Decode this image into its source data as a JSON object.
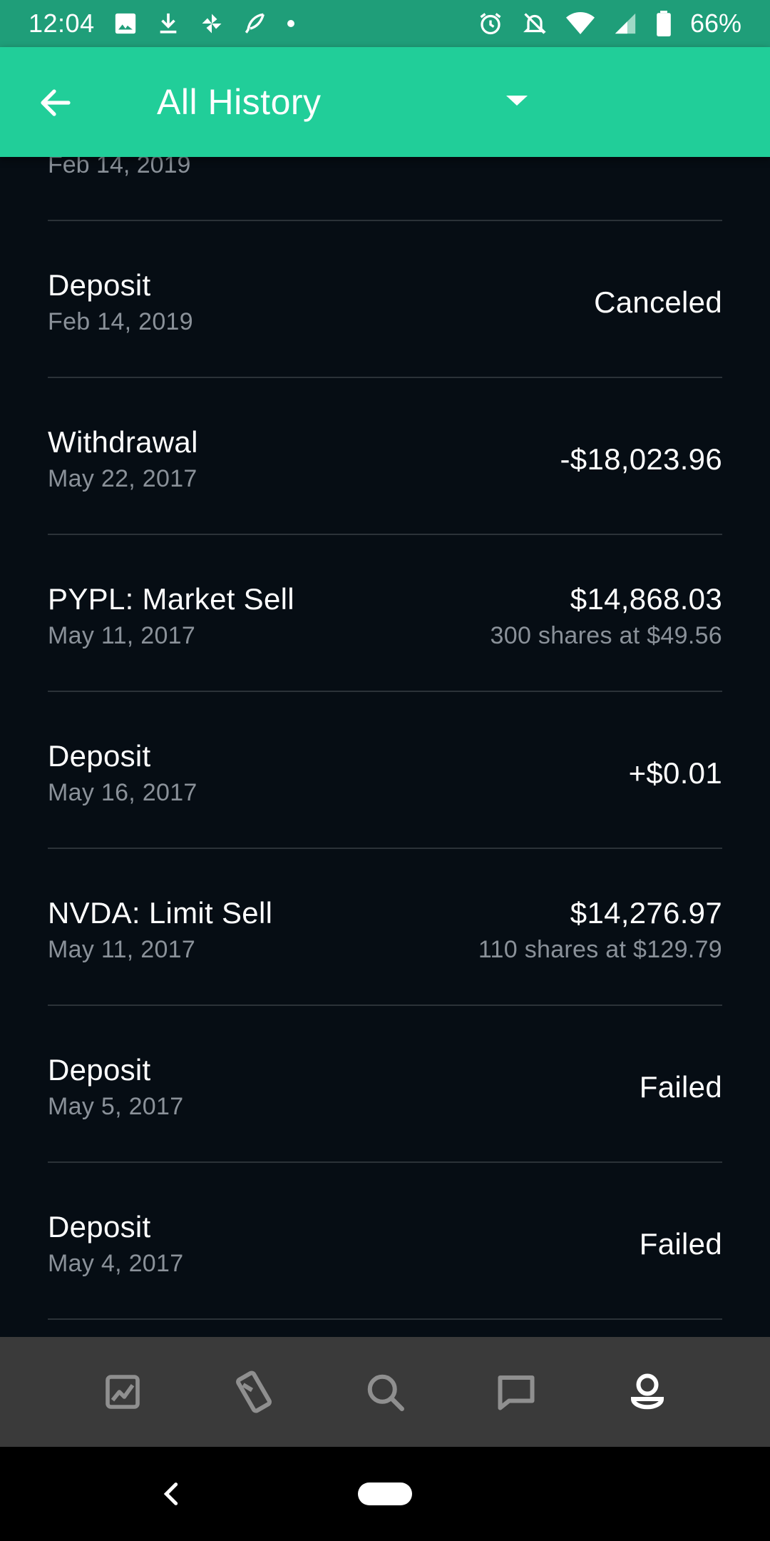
{
  "status_bar": {
    "time": "12:04",
    "battery": "66%",
    "icons": [
      "image-icon",
      "download-icon",
      "pinwheel-icon",
      "feather-icon",
      "dot-icon",
      "alarm-icon",
      "bell-off-icon",
      "wifi-icon",
      "signal-icon",
      "battery-icon"
    ]
  },
  "app_bar": {
    "title": "All History",
    "back_icon": "arrow-left-icon",
    "dropdown_icon": "caret-down-icon"
  },
  "history": {
    "partial_row_date": "Feb 14, 2019",
    "rows": [
      {
        "title": "Deposit",
        "date": "Feb 14, 2019",
        "amount": "Canceled",
        "detail": ""
      },
      {
        "title": "Withdrawal",
        "date": "May 22, 2017",
        "amount": "-$18,023.96",
        "detail": ""
      },
      {
        "title": "PYPL: Market Sell",
        "date": "May 11, 2017",
        "amount": "$14,868.03",
        "detail": "300 shares at $49.56"
      },
      {
        "title": "Deposit",
        "date": "May 16, 2017",
        "amount": "+$0.01",
        "detail": ""
      },
      {
        "title": "NVDA: Limit Sell",
        "date": "May 11, 2017",
        "amount": "$14,276.97",
        "detail": "110 shares at $129.79"
      },
      {
        "title": "Deposit",
        "date": "May 5, 2017",
        "amount": "Failed",
        "detail": ""
      },
      {
        "title": "Deposit",
        "date": "May 4, 2017",
        "amount": "Failed",
        "detail": ""
      }
    ]
  },
  "bottom_nav": {
    "items": [
      "chart-icon",
      "card-icon",
      "search-icon",
      "chat-icon",
      "account-icon"
    ],
    "active": "account-icon"
  },
  "colors": {
    "brand": "#21ce99",
    "status_bar": "#1f9e79",
    "background": "#060d14",
    "muted_text": "#8a9199",
    "divider": "#2b3238",
    "nav_background": "#3a3a3a"
  }
}
